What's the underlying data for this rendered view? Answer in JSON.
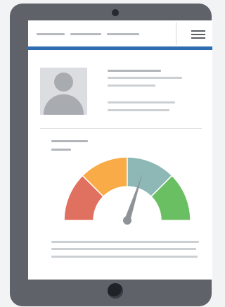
{
  "device": "tablet",
  "navbar": {
    "menu_icon": "hamburger-menu-icon",
    "accent_color": "#2f6db1"
  },
  "profile": {
    "avatar_icon": "user-avatar-icon"
  },
  "gauge": {
    "needle_icon": "gauge-needle-icon",
    "segments": [
      {
        "color": "#e0705f"
      },
      {
        "color": "#f8ab46"
      },
      {
        "color": "#8db8b5"
      },
      {
        "color": "#6bbf63"
      }
    ],
    "level": 0.6
  }
}
